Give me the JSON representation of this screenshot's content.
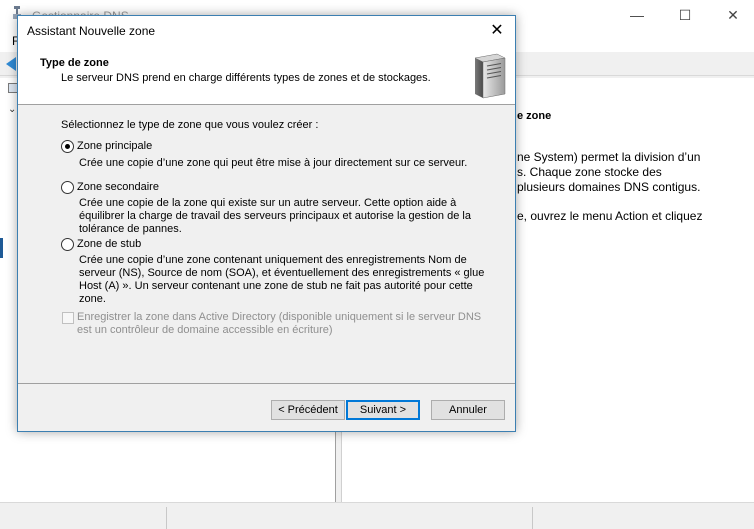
{
  "background_app": {
    "title": "Gestionnaire DNS",
    "menu_first": "F",
    "window_controls": {
      "minimize": "—",
      "maximize": "☐",
      "close": "✕"
    },
    "right_pane": {
      "title": "e zone",
      "line1": "ne System) permet la division d’un",
      "line2": "s. Chaque zone stocke des",
      "line3": " plusieurs domaines DNS contigus.",
      "line4": "e, ouvrez le menu Action et cliquez"
    }
  },
  "wizard": {
    "title": "Assistant Nouvelle zone",
    "close": "✕",
    "heading": "Type de zone",
    "subheading": "Le serveur DNS prend en charge différents types de zones et de stockages.",
    "prompt": "Sélectionnez le type de zone que vous voulez créer :",
    "options": [
      {
        "label": "Zone principale",
        "description": "Crée une copie d’une zone qui peut être mise à jour directement sur ce serveur.",
        "checked": true
      },
      {
        "label": "Zone secondaire",
        "description": "Crée une copie de la zone qui existe sur un autre serveur. Cette option aide à équilibrer la charge de travail des serveurs principaux et autorise la gestion de la tolérance de pannes.",
        "checked": false
      },
      {
        "label": "Zone de stub",
        "description": "Crée une copie d’une zone contenant uniquement des enregistrements Nom de serveur (NS), Source de nom (SOA), et éventuellement des enregistrements « glue Host (A) ». Un serveur contenant une zone de stub ne fait pas autorité pour cette zone.",
        "checked": false
      }
    ],
    "ad_checkbox_label": "Enregistrer la zone dans Active Directory (disponible uniquement si le serveur DNS est un contrôleur de domaine accessible en écriture)",
    "buttons": {
      "previous": "< Précédent",
      "next": "Suivant >",
      "cancel": "Annuler"
    }
  },
  "colors": {
    "dialog_border": "#3c7fb1",
    "default_button_border": "#0078d7",
    "disabled_text": "#8f8f8f"
  }
}
